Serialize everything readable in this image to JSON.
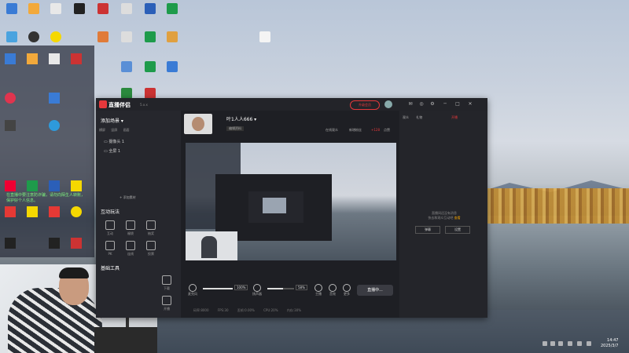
{
  "app": {
    "title": "直播伴侣",
    "version": "5.x.x",
    "upgrade_label": "升级会员",
    "window_controls": [
      "─",
      "□",
      "✕"
    ]
  },
  "sidebar": {
    "scene_header": "添加场景 ▾",
    "tabs": [
      "横屏",
      "竖屏",
      "画面"
    ],
    "scenes": [
      {
        "label": "摄像头 1"
      },
      {
        "label": "全屏 1"
      }
    ],
    "add_source": "+ 添加素材",
    "interaction_title": "互动玩法",
    "interaction_tools": [
      "互动",
      "福袋",
      "抽奖",
      "PK",
      "连线",
      "投票"
    ],
    "base_title": "基础工具",
    "base_tools": [
      "下载",
      "开播"
    ]
  },
  "streamer": {
    "name": "叶1人人666 ▾",
    "tag": "编辑资料",
    "stats": [
      "在线观众",
      "新增粉丝",
      "+128",
      "点赞"
    ]
  },
  "controls": {
    "mic_label": "麦克风",
    "mic_percent": "100%",
    "mic_level": 1.0,
    "speaker_label": "扬声器",
    "speaker_percent": "58%",
    "speaker_level": 0.58,
    "buttons": [
      "主播",
      "音效",
      "更多"
    ],
    "live_button": "直播中..."
  },
  "status": {
    "items": [
      "码率:8000",
      "FPS:30",
      "丢帧:0.00%",
      "CPU:20%",
      "内存:30%"
    ]
  },
  "right_panel": {
    "tabs": [
      "观众",
      "礼物"
    ],
    "red_label": "开播",
    "empty_message": "直播间还没有消息",
    "hint": "快去和观众互动吧",
    "link": "查看",
    "buttons": [
      "弹幕",
      "设置"
    ]
  },
  "desktop": {
    "left_panel_text": "在直播中要注意防诈骗，请勿向陌生人转账，保护好个人信息。"
  },
  "clock": {
    "time": "14:47",
    "date": "2025/3/7"
  },
  "colors": {
    "accent_red": "#e5383b",
    "app_bg": "#1e1f24",
    "link_orange": "#f0a000"
  }
}
